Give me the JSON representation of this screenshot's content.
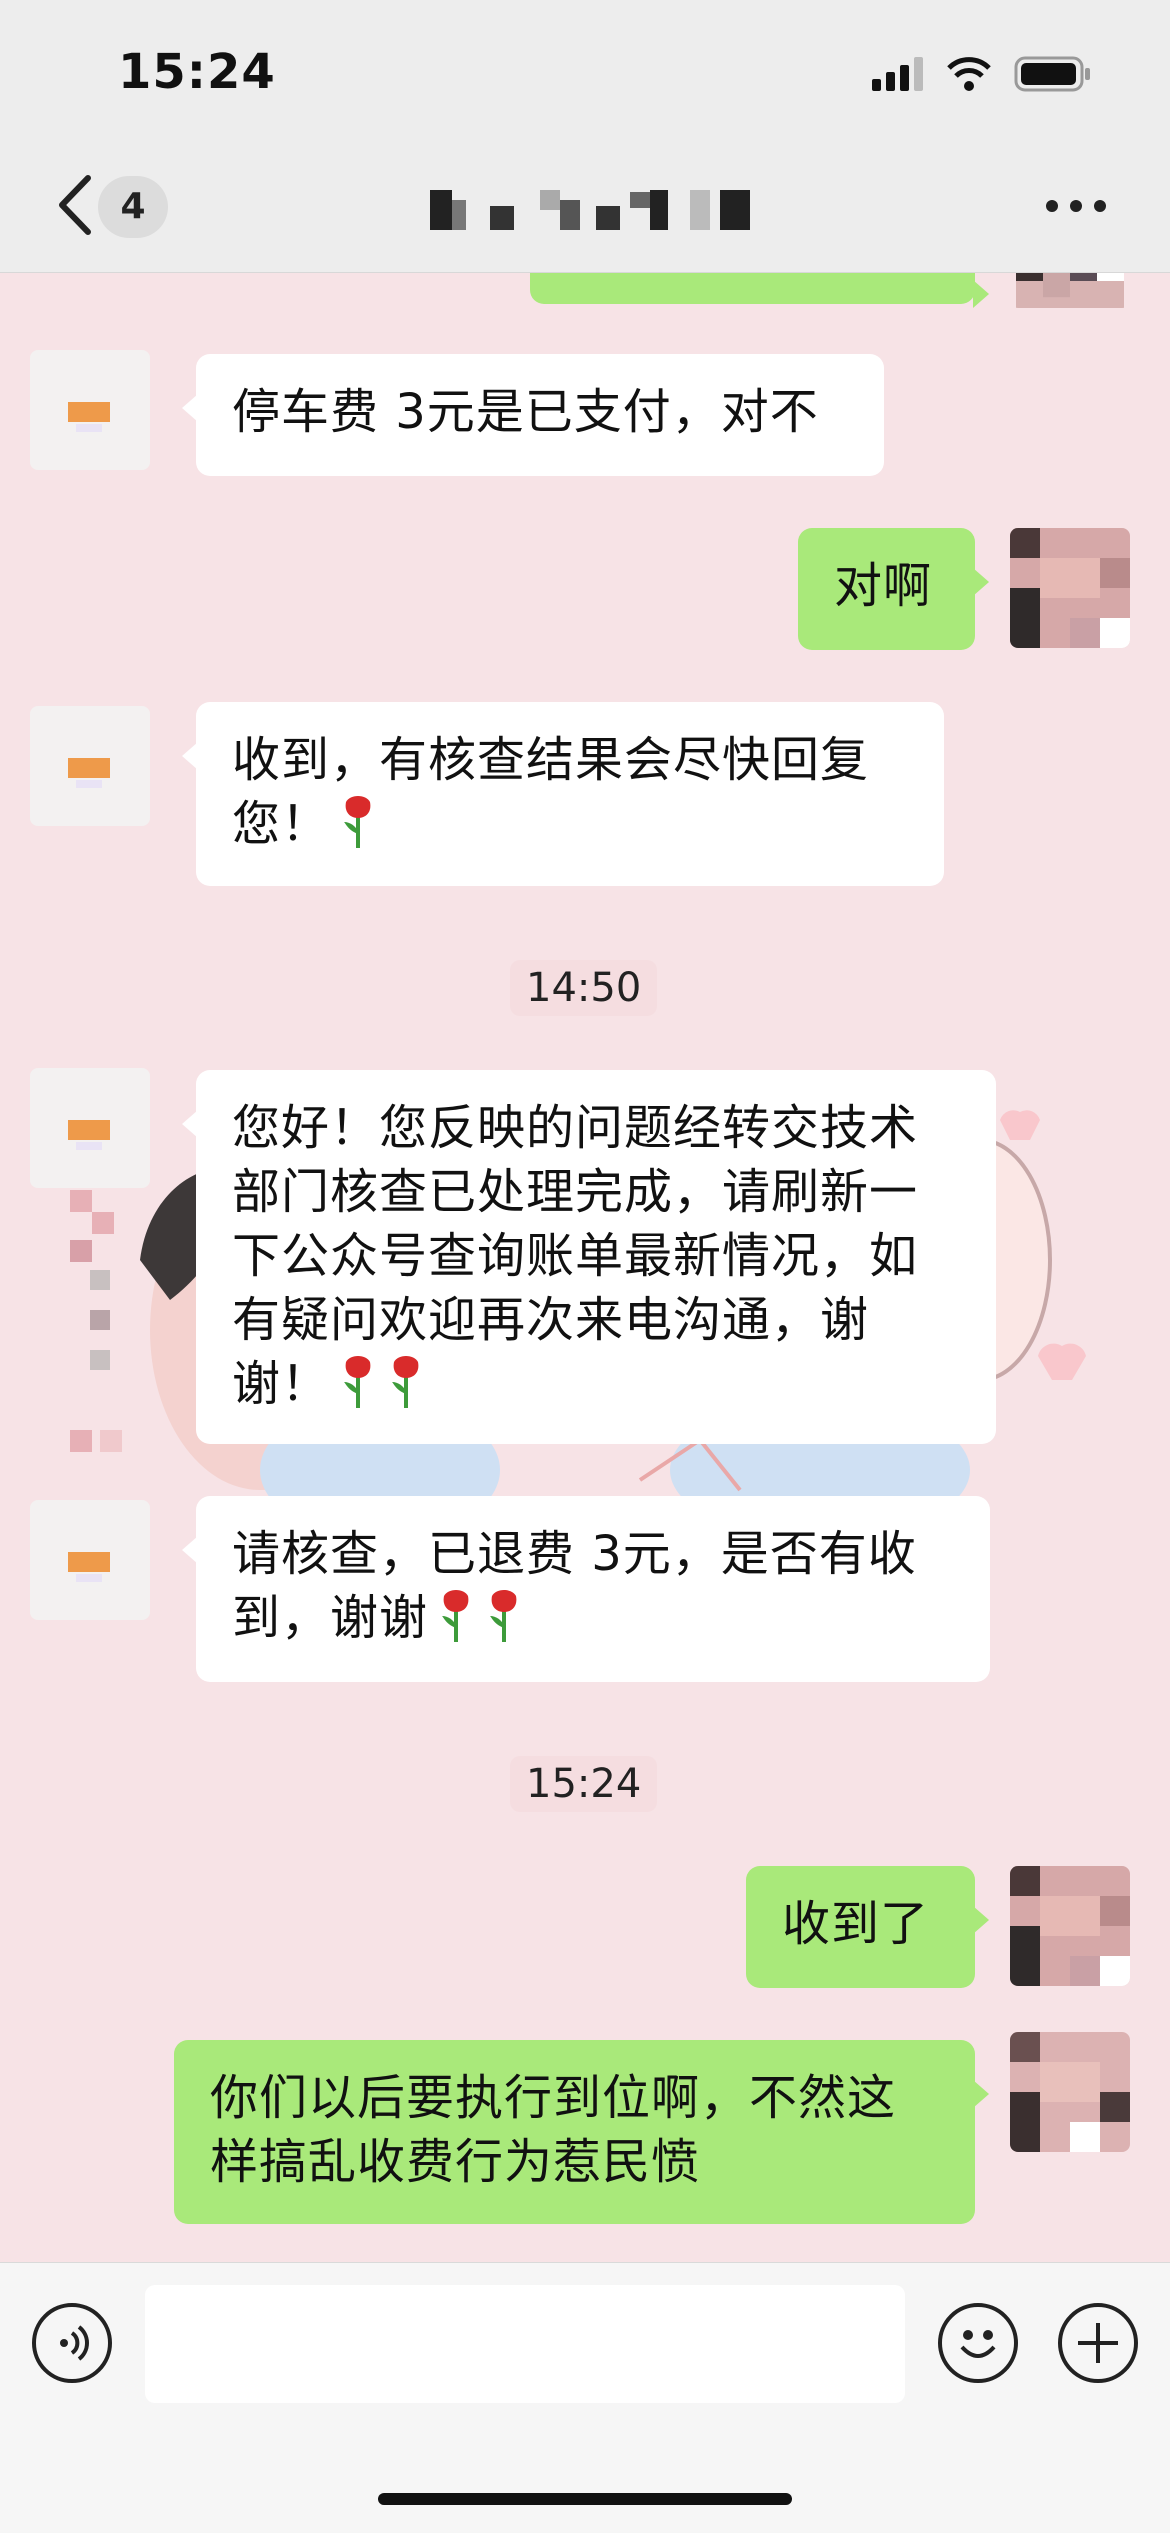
{
  "status_bar": {
    "time": "15:24"
  },
  "header": {
    "back_label": "<",
    "unread_count": "4"
  },
  "messages": [
    {
      "side": "in",
      "text": "停车费 3元是已支付，对不"
    },
    {
      "side": "out",
      "text": "对啊"
    },
    {
      "side": "in",
      "text": "收到，有核查结果会尽快回复您！",
      "flowers": 1
    },
    {
      "type": "time",
      "text": "14:50"
    },
    {
      "side": "in",
      "text": "您好！您反映的问题经转交技术部门核查已处理完成，请刷新一下公众号查询账单最新情况，如有疑问欢迎再次来电沟通，谢谢！",
      "flowers": 2
    },
    {
      "side": "in",
      "text": "请核查，已退费 3元，是否有收到，谢谢",
      "flowers": 2
    },
    {
      "type": "time",
      "text": "15:24"
    },
    {
      "side": "out",
      "text": "收到了"
    },
    {
      "side": "out",
      "text": "你们以后要执行到位啊，不然这样搞乱收费行为惹民愤"
    }
  ],
  "input_bar": {
    "value": ""
  },
  "colors": {
    "outgoing": "#a9e97a",
    "incoming": "#ffffff",
    "background": "#f7e3e6"
  },
  "icons": [
    "back-chevron-icon",
    "more-dots-icon",
    "voice-icon",
    "emoji-icon",
    "plus-icon",
    "rose-icon",
    "signal-icon",
    "wifi-icon",
    "battery-icon"
  ]
}
